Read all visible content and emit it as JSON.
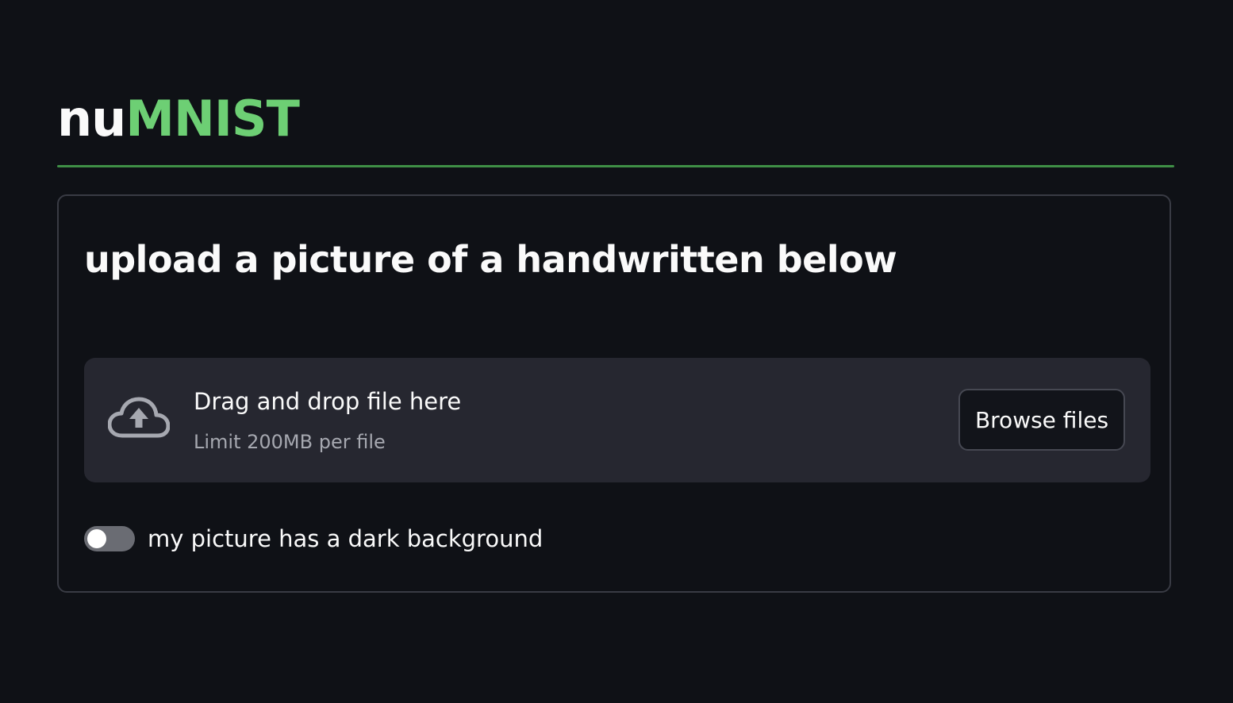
{
  "header": {
    "title_part1": "nu",
    "title_part2": "MNIST"
  },
  "form": {
    "heading": "upload a picture of a handwritten below",
    "uploader": {
      "icon": "cloud-upload-icon",
      "drop_text": "Drag and drop file here",
      "limit_text": "Limit 200MB per file",
      "browse_label": "Browse files"
    },
    "toggle": {
      "label": "my picture has a dark background",
      "checked": false
    }
  },
  "colors": {
    "background": "#0f1116",
    "accent": "#6dcf74",
    "divider": "#3f8f46",
    "dropzone": "#262730",
    "text": "#fafafa",
    "muted_text": "#a6a8b0"
  }
}
